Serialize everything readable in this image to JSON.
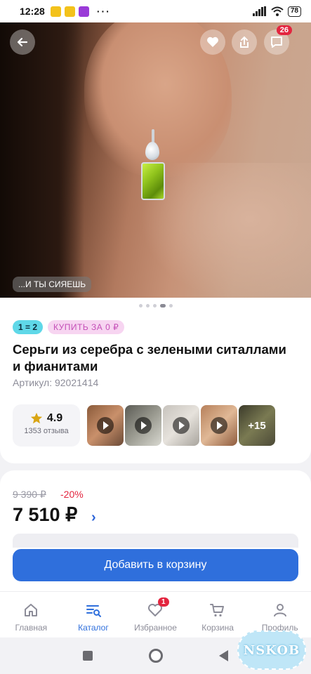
{
  "status_bar": {
    "time": "12:28",
    "dots": "···",
    "battery": "78"
  },
  "hero": {
    "caption": "...И ТЫ СИЯЕШЬ",
    "chat_badge": "26",
    "pager": {
      "total": 5,
      "active_index": 3
    }
  },
  "product": {
    "promo_chip": "1 = 2",
    "buy_chip": "КУПИТЬ ЗА 0 ₽",
    "title": "Серьги из серебра с зелеными ситаллами и фианитами",
    "article": "Артикул: 92021414",
    "rating": "4.9",
    "reviews": "1353 отзыва",
    "thumbs_more": "+15"
  },
  "pricing": {
    "old_price": "9 390 ₽",
    "discount": "-20%",
    "price": "7 510 ₽",
    "add_to_cart": "Добавить в корзину"
  },
  "nav": {
    "items": [
      {
        "label": "Главная",
        "icon": "home-icon"
      },
      {
        "label": "Каталог",
        "icon": "catalog-icon"
      },
      {
        "label": "Избранное",
        "icon": "heart-icon",
        "badge": "1"
      },
      {
        "label": "Корзина",
        "icon": "cart-icon"
      },
      {
        "label": "Профиль",
        "icon": "profile-icon"
      }
    ],
    "active": "Каталог"
  },
  "watermark": "NSKOB",
  "colors": {
    "accent": "#2f6fdc",
    "sale": "#e3253f",
    "promo_chip": "#5fd8e8",
    "buy_chip": "#f7d5f1"
  }
}
